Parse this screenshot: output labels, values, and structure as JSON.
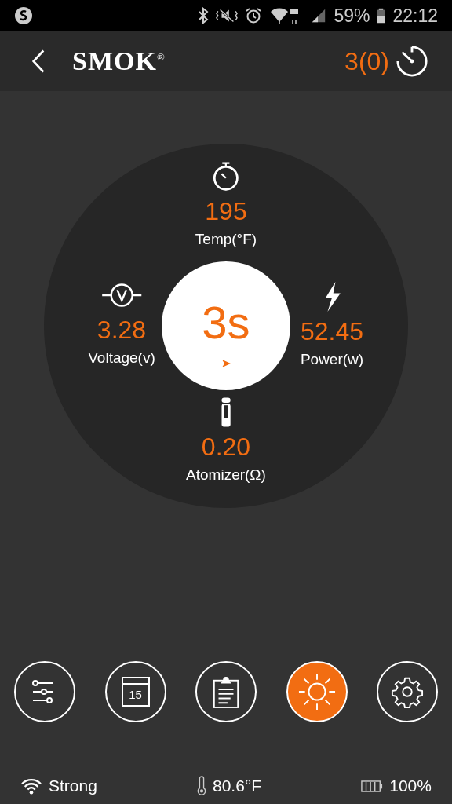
{
  "status_bar": {
    "battery": "59%",
    "time": "22:12"
  },
  "header": {
    "logo": "SMOK$^{®}$",
    "puff_count": "3(0)"
  },
  "timer": {
    "value": "3s"
  },
  "readings": [
    {
      "kind": "temp",
      "value": "195",
      "label": "Temp(°F)"
    },
    {
      "kind": "voltage",
      "value": "3.28",
      "label": "Voltage(v)"
    },
    {
      "kind": "power",
      "value": "52.45",
      "label": "Power(w)"
    },
    {
      "kind": "atomizer",
      "value": "0.20",
      "label": "Atomizer(Ω)"
    }
  ],
  "toolbar": [
    {
      "kind": "sliders",
      "selected": false
    },
    {
      "kind": "calendar",
      "text": "15",
      "selected": false
    },
    {
      "kind": "clipboard",
      "selected": false
    },
    {
      "kind": "sun",
      "selected": true
    },
    {
      "kind": "gear",
      "selected": false
    }
  ],
  "footer": {
    "signal": "Strong",
    "temperature": "80.6°F",
    "battery": "100%"
  }
}
